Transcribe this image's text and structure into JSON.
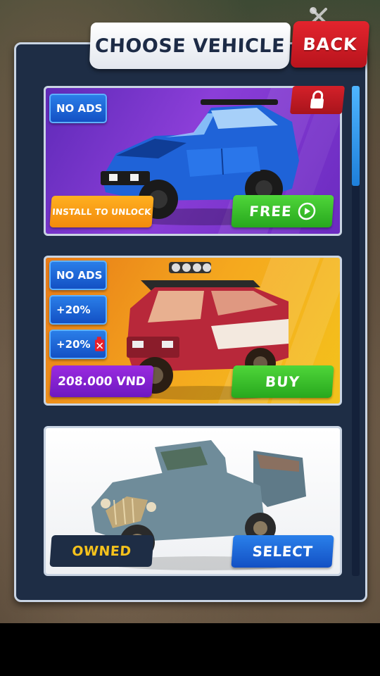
{
  "header": {
    "title": "CHOOSE VEHICLE",
    "back_label": "BACK"
  },
  "colors": {
    "panel": "#1e2d45",
    "accent_red": "#d42029",
    "accent_green": "#27a81d",
    "accent_blue": "#1350c4",
    "owned_text": "#f5c21c"
  },
  "vehicles": [
    {
      "icon": "blue-monster-pickup",
      "badges": [
        "NO ADS"
      ],
      "locked": true,
      "unlock_label": "INSTALL TO UNLOCK",
      "action_label": "FREE",
      "action_icon": "play-circle-icon"
    },
    {
      "icon": "red-offroad-suv",
      "badges": [
        "NO ADS",
        "+20%",
        "+20%"
      ],
      "price": "208.000 VND",
      "action_label": "BUY"
    },
    {
      "icon": "vintage-blue-pickup",
      "status_label": "OWNED",
      "action_label": "SELECT"
    }
  ]
}
